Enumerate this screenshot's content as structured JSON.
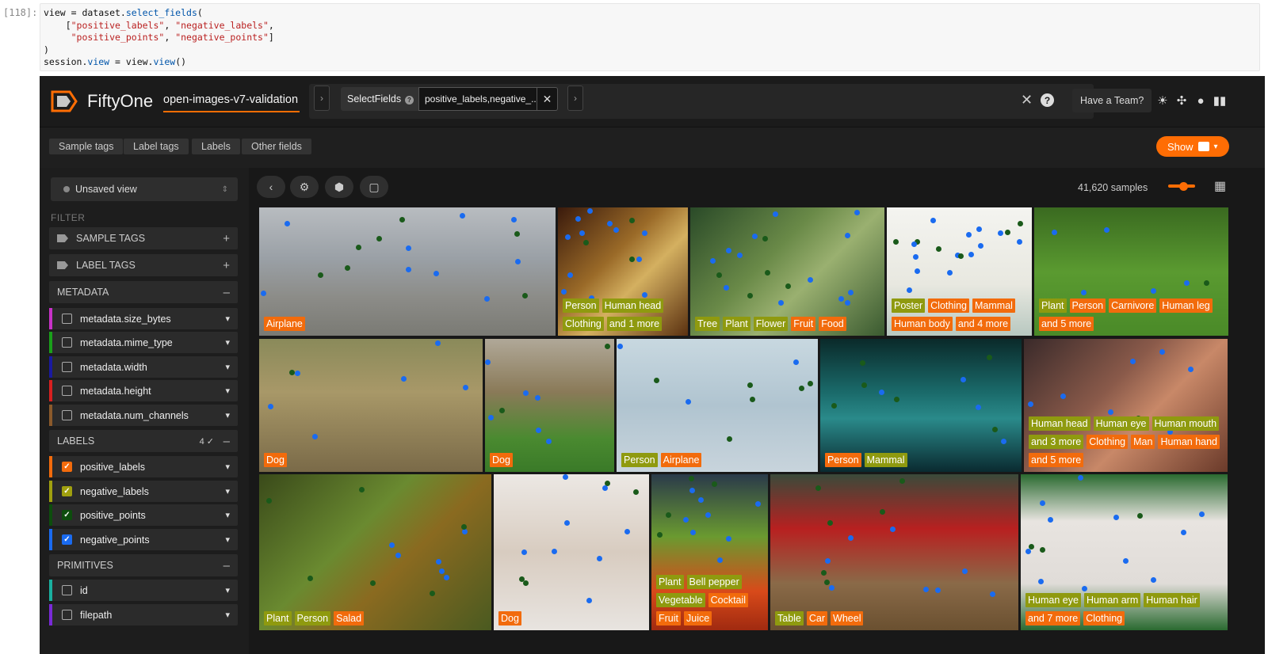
{
  "notebook": {
    "prompt": "[118]:",
    "code": [
      {
        "parts": [
          [
            "t",
            "view = dataset."
          ],
          [
            "a",
            "select_fields"
          ],
          [
            "t",
            "("
          ]
        ]
      },
      {
        "parts": [
          [
            "t",
            "    ["
          ],
          [
            "s",
            "\"positive_labels\""
          ],
          [
            "t",
            ", "
          ],
          [
            "s",
            "\"negative_labels\""
          ],
          [
            "t",
            ","
          ]
        ]
      },
      {
        "parts": [
          [
            "t",
            "     "
          ],
          [
            "s",
            "\"positive_points\""
          ],
          [
            "t",
            ", "
          ],
          [
            "s",
            "\"negative_points\""
          ],
          [
            "t",
            "]"
          ]
        ]
      },
      {
        "parts": [
          [
            "t",
            ")"
          ]
        ]
      },
      {
        "parts": [
          [
            "t",
            "session."
          ],
          [
            "a",
            "view"
          ],
          [
            "t",
            " = view."
          ],
          [
            "a",
            "view"
          ],
          [
            "t",
            "()"
          ]
        ]
      }
    ]
  },
  "app": {
    "brand": "FiftyOne",
    "dataset_name": "open-images-v7-validation",
    "stage": {
      "name": "SelectFields",
      "param": "positive_labels,negative_..."
    },
    "team_button": "Have a Team?",
    "tabs": [
      "Sample tags",
      "Label tags",
      "Labels",
      "Other fields"
    ],
    "show_button": "Show",
    "view_selector": "Unsaved view",
    "filter_header": "FILTER",
    "sample_count": "41,620 samples",
    "colors": {
      "accent": "#ff6d04",
      "orange_label": "#f26b0c",
      "green_label": "#8f9a0f",
      "blue_point": "#1a6bf0",
      "dark_point": "#1a5a1a"
    }
  },
  "sidebar": {
    "tag_rows": [
      {
        "label": "SAMPLE TAGS",
        "action": "+"
      },
      {
        "label": "LABEL TAGS",
        "action": "+"
      }
    ],
    "metadata_header": "METADATA",
    "metadata_fields": [
      {
        "name": "metadata.size_bytes",
        "color": "#c832c8",
        "checked": false
      },
      {
        "name": "metadata.mime_type",
        "color": "#1aa01a",
        "checked": false
      },
      {
        "name": "metadata.width",
        "color": "#1a1aa0",
        "checked": false
      },
      {
        "name": "metadata.height",
        "color": "#d82020",
        "checked": false
      },
      {
        "name": "metadata.num_channels",
        "color": "#8b5a2b",
        "checked": false
      }
    ],
    "labels_header": "LABELS",
    "labels_count": "4",
    "label_fields": [
      {
        "name": "positive_labels",
        "color": "#f26b0c",
        "checked": true,
        "check_bg": "#f26b0c"
      },
      {
        "name": "negative_labels",
        "color": "#a0a00f",
        "checked": true,
        "check_bg": "#a0a00f"
      },
      {
        "name": "positive_points",
        "color": "#0d4d0d",
        "checked": true,
        "check_bg": "#0d4d0d"
      },
      {
        "name": "negative_points",
        "color": "#1a6bf0",
        "checked": true,
        "check_bg": "#1a6bf0"
      }
    ],
    "primitives_header": "PRIMITIVES",
    "primitive_fields": [
      {
        "name": "id",
        "color": "#1ab0a0",
        "checked": false
      },
      {
        "name": "filepath",
        "color": "#7a2ad8",
        "checked": false
      }
    ]
  },
  "grid": {
    "tiles": [
      {
        "desc": "airplane",
        "bg": "linear-gradient(180deg,#b8bcc0 0%,#9aa0a6 40%,#8c8c88 70%,#7a7a74 100%)",
        "labels": [
          [
            "Airplane"
          ]
        ],
        "label_colors": [
          [
            "o"
          ]
        ]
      },
      {
        "desc": "golden objects",
        "bg": "linear-gradient(135deg,#3a1a0c 0%,#9a6a28 40%,#d4b060 60%,#5a3010 100%)",
        "labels": [
          [
            "Person",
            "Human head"
          ],
          [
            "Clothing",
            "and 1 more"
          ]
        ],
        "label_colors": [
          [
            "g",
            "g"
          ],
          [
            "g",
            "g"
          ]
        ]
      },
      {
        "desc": "red berries",
        "bg": "linear-gradient(135deg,#2a4a28 0%,#6a8a48 40%,#9ab070 60%,#3a5a30 100%)",
        "labels": [
          [
            "Tree",
            "Plant",
            "Flower",
            "Fruit",
            "Food"
          ]
        ],
        "label_colors": [
          [
            "g",
            "g",
            "g",
            "o",
            "o"
          ]
        ]
      },
      {
        "desc": "illustration",
        "bg": "linear-gradient(180deg,#f4f4f0 0%,#e8e8e0 60%,#b8c8c0 100%)",
        "labels": [
          [
            "Poster",
            "Clothing",
            "Mammal"
          ],
          [
            "Human body",
            "and 4 more"
          ]
        ],
        "label_colors": [
          [
            "g",
            "o",
            "o"
          ],
          [
            "o",
            "o"
          ]
        ]
      },
      {
        "desc": "dog on grass",
        "bg": "linear-gradient(180deg,#3a6a20 0%,#5a9a30 50%,#4a8a28 100%)",
        "labels": [
          [
            "Plant",
            "Person",
            "Carnivore",
            "Human leg"
          ],
          [
            "and 5 more"
          ]
        ],
        "label_colors": [
          [
            "g",
            "o",
            "o",
            "o"
          ],
          [
            "o"
          ]
        ]
      },
      {
        "desc": "dog lying",
        "bg": "linear-gradient(180deg,#8a8a5a 0%,#a89868 40%,#7a6a48 100%)",
        "labels": [
          [
            "Dog"
          ]
        ],
        "label_colors": [
          [
            "o"
          ]
        ]
      },
      {
        "desc": "german shepherd",
        "bg": "linear-gradient(180deg,#b0a898 0%,#8a7a58 40%,#4a8a30 75%,#3a7a28 100%)",
        "labels": [
          [
            "Dog"
          ]
        ],
        "label_colors": [
          [
            "o"
          ]
        ]
      },
      {
        "desc": "jet in sky",
        "bg": "linear-gradient(180deg,#c8d8e0 0%,#b0c4d0 50%,#c8d4dc 100%)",
        "labels": [
          [
            "Person",
            "Airplane"
          ]
        ],
        "label_colors": [
          [
            "g",
            "o"
          ]
        ]
      },
      {
        "desc": "underwater cave",
        "bg": "linear-gradient(180deg,#0a2a2a 0%,#1a6a6a 40%,#2a8a8a 60%,#0a2a30 100%)",
        "labels": [
          [
            "Person",
            "Mammal"
          ]
        ],
        "label_colors": [
          [
            "o",
            "g"
          ]
        ]
      },
      {
        "desc": "henna hands",
        "bg": "linear-gradient(135deg,#3a2a2a 0%,#8a5a4a 40%,#c88868 60%,#6a3a2a 100%)",
        "labels": [
          [
            "Human head",
            "Human eye",
            "Human mouth"
          ],
          [
            "and 3 more",
            "Clothing",
            "Man",
            "Human hand"
          ],
          [
            "and 5 more"
          ]
        ],
        "label_colors": [
          [
            "g",
            "g",
            "g"
          ],
          [
            "g",
            "o",
            "o",
            "o"
          ],
          [
            "o"
          ]
        ]
      },
      {
        "desc": "salad",
        "bg": "linear-gradient(135deg,#3a4a1a 0%,#6a8a30 40%,#8a6a20 60%,#4a5a20 100%)",
        "labels": [
          [
            "Plant",
            "Person",
            "Salad"
          ]
        ],
        "label_colors": [
          [
            "g",
            "g",
            "o"
          ]
        ]
      },
      {
        "desc": "dog in snow",
        "bg": "linear-gradient(180deg,#ece8e4 0%,#d8ccc0 50%,#e8e4e0 100%)",
        "labels": [
          [
            "Dog"
          ]
        ],
        "label_colors": [
          [
            "o"
          ]
        ]
      },
      {
        "desc": "bloody mary",
        "bg": "linear-gradient(180deg,#2a3a4a 0%,#6a9a30 40%,#d84a1a 75%,#a02a10 100%)",
        "labels": [
          [
            "Plant",
            "Bell pepper"
          ],
          [
            "Vegetable",
            "Cocktail"
          ],
          [
            "Fruit",
            "Juice"
          ]
        ],
        "label_colors": [
          [
            "g",
            "g"
          ],
          [
            "g",
            "o"
          ],
          [
            "o",
            "o"
          ]
        ]
      },
      {
        "desc": "red car",
        "bg": "linear-gradient(180deg,#3a4a3a 0%,#b82020 35%,#8a6a48 70%,#6a5030 100%)",
        "labels": [
          [
            "Table",
            "Car",
            "Wheel"
          ]
        ],
        "label_colors": [
          [
            "g",
            "o",
            "o"
          ]
        ]
      },
      {
        "desc": "clothing on grass",
        "bg": "linear-gradient(180deg,#2a6a30 0%,#e8e4e0 30%,#e0dcd8 70%,#2a6a30 100%)",
        "labels": [
          [
            "Human eye",
            "Human arm",
            "Human hair"
          ],
          [
            "and 7 more",
            "Clothing"
          ]
        ],
        "label_colors": [
          [
            "g",
            "g",
            "g"
          ],
          [
            "o",
            "o"
          ]
        ]
      }
    ]
  }
}
